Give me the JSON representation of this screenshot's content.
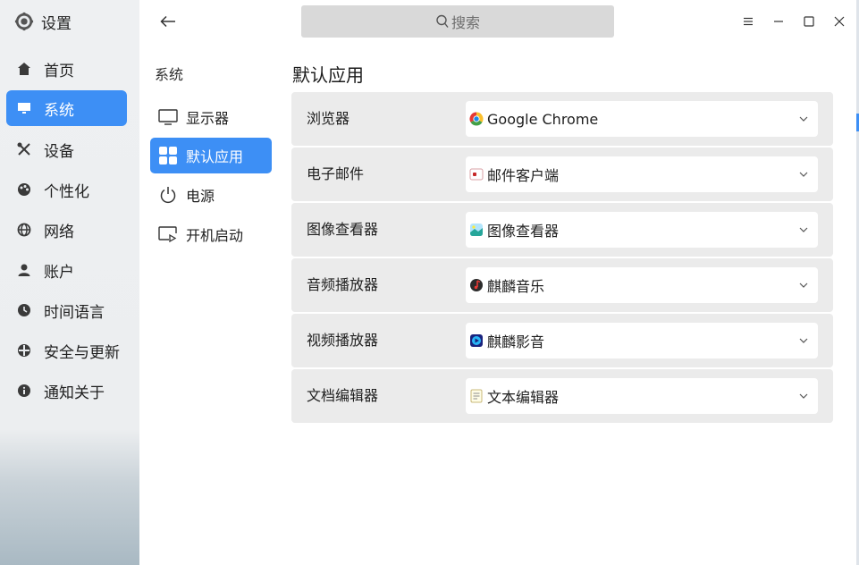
{
  "nav": {
    "title": "设置",
    "items": [
      {
        "label": "首页",
        "icon": "home-icon"
      },
      {
        "label": "系统",
        "icon": "monitor-icon",
        "active": true
      },
      {
        "label": "设备",
        "icon": "tools-icon"
      },
      {
        "label": "个性化",
        "icon": "palette-icon"
      },
      {
        "label": "网络",
        "icon": "globe-icon"
      },
      {
        "label": "账户",
        "icon": "user-icon"
      },
      {
        "label": "时间语言",
        "icon": "clock-icon"
      },
      {
        "label": "安全与更新",
        "icon": "shield-icon"
      },
      {
        "label": "通知关于",
        "icon": "info-icon"
      }
    ]
  },
  "header": {
    "search_placeholder": "搜索"
  },
  "sub_nav": {
    "title": "系统",
    "items": [
      {
        "label": "显示器",
        "icon": "display-icon"
      },
      {
        "label": "默认应用",
        "icon": "grid-icon",
        "active": true
      },
      {
        "label": "电源",
        "icon": "power-icon"
      },
      {
        "label": "开机启动",
        "icon": "autostart-icon"
      }
    ]
  },
  "main": {
    "title": "默认应用",
    "rows": [
      {
        "label": "浏览器",
        "value": "Google Chrome",
        "icon": "chrome-icon"
      },
      {
        "label": "电子邮件",
        "value": "邮件客户端",
        "icon": "mail-client-icon"
      },
      {
        "label": "图像查看器",
        "value": "图像查看器",
        "icon": "image-viewer-icon"
      },
      {
        "label": "音频播放器",
        "value": "麒麟音乐",
        "icon": "music-icon"
      },
      {
        "label": "视频播放器",
        "value": "麒麟影音",
        "icon": "video-icon"
      },
      {
        "label": "文档编辑器",
        "value": "文本编辑器",
        "icon": "text-editor-icon"
      }
    ]
  },
  "colors": {
    "accent": "#3d8ff5",
    "row_background": "#ebebeb",
    "search_background": "#d9d9d9"
  }
}
